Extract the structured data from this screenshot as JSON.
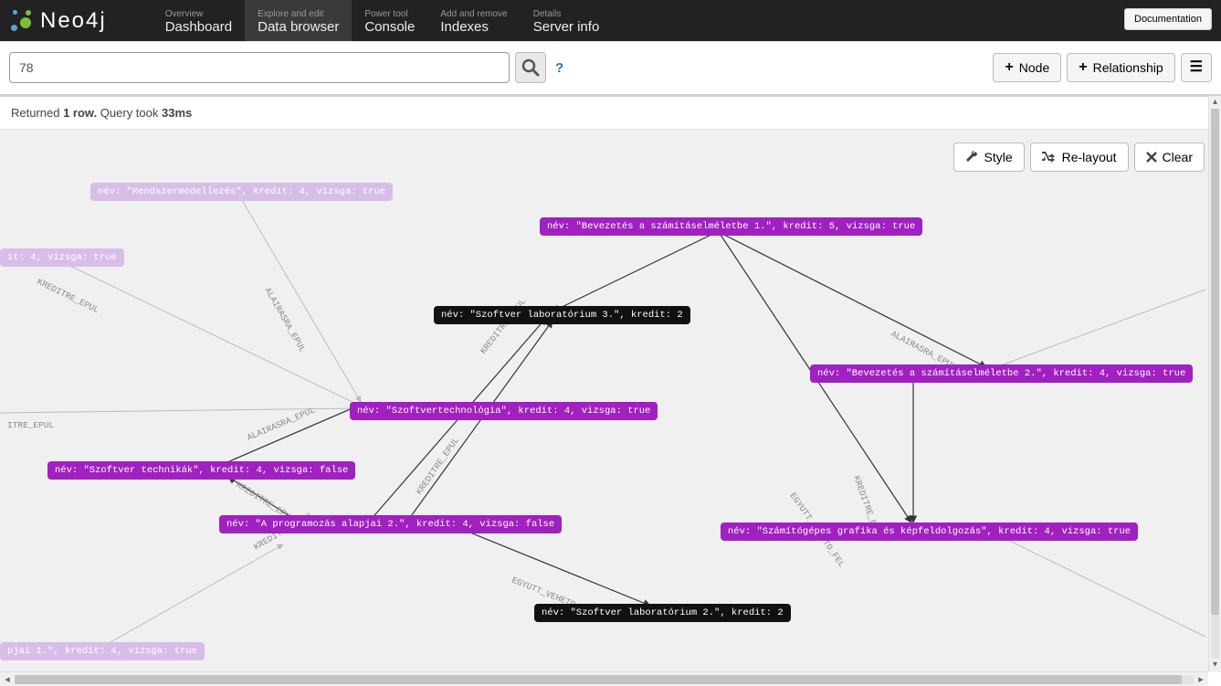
{
  "brand": "Neo4j",
  "nav": {
    "documentation": "Documentation",
    "tabs": [
      {
        "sub": "Overview",
        "main": "Dashboard"
      },
      {
        "sub": "Explore and edit",
        "main": "Data browser"
      },
      {
        "sub": "Power tool",
        "main": "Console"
      },
      {
        "sub": "Add and remove",
        "main": "Indexes"
      },
      {
        "sub": "Details",
        "main": "Server info"
      }
    ]
  },
  "query": {
    "value": "78",
    "node_btn": "Node",
    "relationship_btn": "Relationship"
  },
  "result": {
    "prefix": "Returned ",
    "rows": "1 row.",
    "mid": "   Query took ",
    "time": "33ms"
  },
  "graph_toolbar": {
    "style": "Style",
    "relayout": "Re-layout",
    "clear": "Clear"
  },
  "nodes": {
    "n1": "név: \"Rendszermodellezés\", kredit: 4, vizsga: true",
    "n2": "it: 4, vizsga: true",
    "n3": "ITRE_EPUL",
    "n4": "név: \"Szoftvertechnológia\", kredit: 4, vizsga: true",
    "n5": "név: \"Szoftver technikák\", kredit: 4, vizsga: false",
    "n6": "név: \"A programozás alapjai 2.\", kredit: 4, vizsga: false",
    "n7": "pjai 1.\", kredit: 4, vizsga: true",
    "n8": "név: \"Szoftver laboratórium 3.\", kredit: 2",
    "n9": "név: \"Szoftver laboratórium 2.\", kredit: 2",
    "n10": "név: \"Bevezetés a számításelméletbe 1.\", kredit: 5, vizsga: true",
    "n11": "név: \"Bevezetés a számításelméletbe 2.\", kredit: 4, vizsga: true",
    "n12": "név: \"Számítógépes grafika és képfeldolgozás\", kredit: 4, vizsga: true"
  },
  "edges": {
    "e1": "ALAIRASRA_EPUL",
    "e2": "KREDITRE_EPUL",
    "e3": "ALAIRASRA_EPUL",
    "e4": "KREDITRE_EPUL",
    "e5": "KREDITRE_EPUL",
    "e6": "KREDITRE_EPUL",
    "e7": "KREDITRE_EPUL",
    "e8": "EGYUTT_VEHETO_FEL",
    "e9": "ALAIRASRA_EPUL",
    "e10": "KREDITRE_EPUL",
    "e11": "EGYUTT_VEHETO_FEL"
  }
}
